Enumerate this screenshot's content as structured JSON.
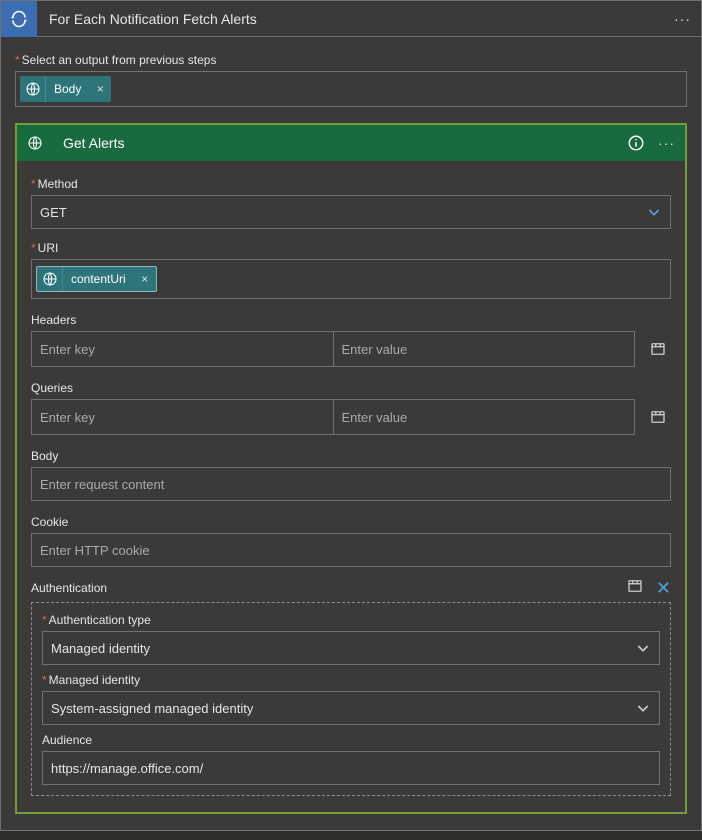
{
  "outer": {
    "title": "For Each Notification Fetch Alerts",
    "select_label": "Select an output from previous steps",
    "token_body": "Body"
  },
  "inner": {
    "title": "Get Alerts",
    "method_label": "Method",
    "method_value": "GET",
    "uri_label": "URI",
    "uri_token": "contentUri",
    "headers_label": "Headers",
    "key_placeholder": "Enter key",
    "value_placeholder": "Enter value",
    "queries_label": "Queries",
    "body_label": "Body",
    "body_placeholder": "Enter request content",
    "cookie_label": "Cookie",
    "cookie_placeholder": "Enter HTTP cookie",
    "auth_label": "Authentication",
    "auth_type_label": "Authentication type",
    "auth_type_value": "Managed identity",
    "managed_identity_label": "Managed identity",
    "managed_identity_value": "System-assigned managed identity",
    "audience_label": "Audience",
    "audience_value": "https://manage.office.com/"
  }
}
